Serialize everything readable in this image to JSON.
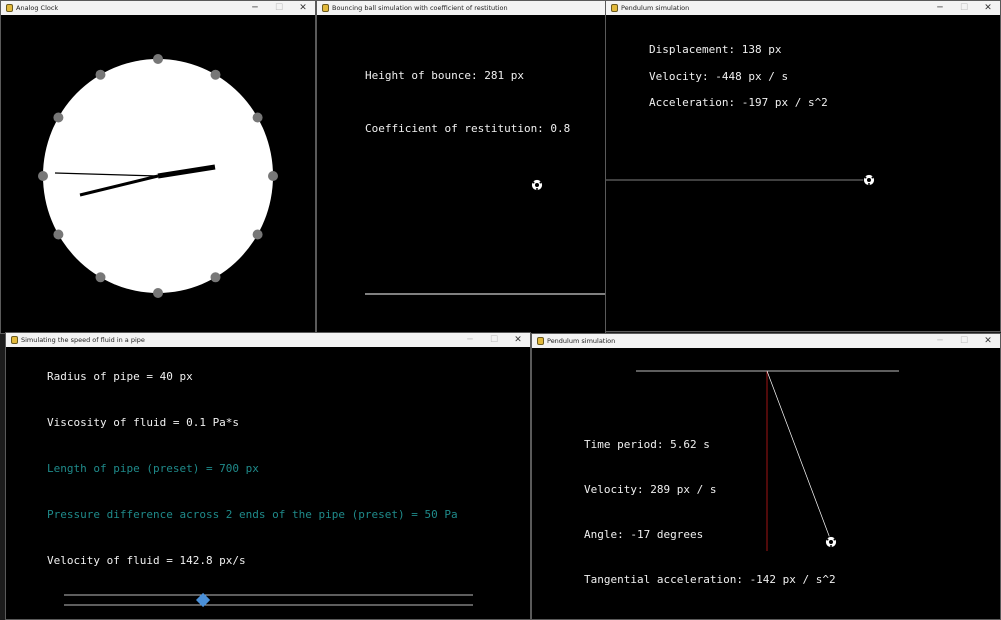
{
  "windows": {
    "clock": {
      "title": "Analog Clock",
      "controls": {
        "minimize": "─",
        "maximize": "☐",
        "close": "✕"
      }
    },
    "bounce": {
      "title": "Bouncing ball simulation with coefficient of restitution",
      "height_label": "Height of bounce: 281 px",
      "restitution_label": "Coefficient of restitution: 0.8"
    },
    "pendulum_top": {
      "title": "Pendulum simulation",
      "controls": {
        "minimize": "─",
        "maximize": "☐",
        "close": "✕"
      },
      "displacement_label": "Displacement: 138 px",
      "velocity_label": "Velocity: -448 px / s",
      "acceleration_label": "Acceleration: -197 px / s^2"
    },
    "fluid": {
      "title": "Simulating the speed of fluid in a pipe",
      "controls": {
        "minimize": "─",
        "maximize": "☐",
        "close": "✕"
      },
      "radius_label": "Radius of pipe = 40 px",
      "viscosity_label": "Viscosity of fluid = 0.1 Pa*s",
      "length_label": "Length of pipe (preset) = 700 px",
      "pressure_label": "Pressure difference across 2 ends of the pipe (preset) = 50 Pa",
      "velocity_label": "Velocity of fluid = 142.8 px/s",
      "slider_fraction": 0.34
    },
    "pendulum_bottom": {
      "title": "Pendulum simulation",
      "controls": {
        "minimize": "─",
        "maximize": "☐",
        "close": "✕"
      },
      "period_label": "Time period: 5.62 s",
      "velocity_label": "Velocity: 289 px / s",
      "angle_label": "Angle: -17 degrees",
      "tangential_label": "Tangential acceleration: -142 px / s^2"
    }
  },
  "colors": {
    "teal_text": "#1f8a8a",
    "slider_thumb": "#4a90d9",
    "pendulum_red": "#a01414",
    "clock_marker": "#777777"
  },
  "icons": [
    "python-app-icon",
    "soccer-ball-icon"
  ]
}
